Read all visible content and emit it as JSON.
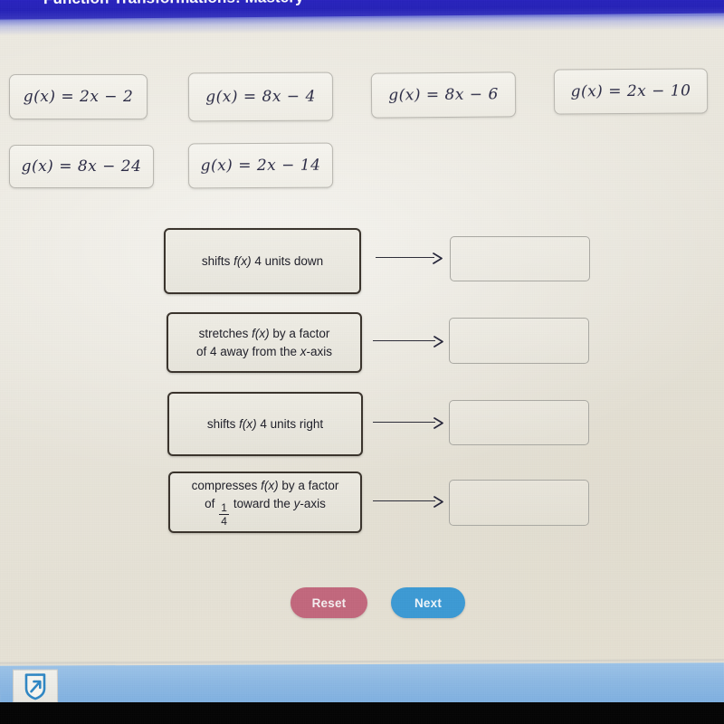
{
  "header": {
    "title": "Function Transformations: Mastery",
    "background_color": "#2622b8"
  },
  "equation_tiles": [
    {
      "label": "g(x)  =  2x  −  2",
      "name": "equation-tile-1"
    },
    {
      "label": "g(x)  =  8x  −  4",
      "name": "equation-tile-2"
    },
    {
      "label": "g(x)  =  8x  −  6",
      "name": "equation-tile-3"
    },
    {
      "label": "g(x)  =  2x  −  10",
      "name": "equation-tile-4"
    },
    {
      "label": "g(x)  =  8x  −  24",
      "name": "equation-tile-5"
    },
    {
      "label": "g(x)  =  2x  −  14",
      "name": "equation-tile-6"
    }
  ],
  "match_rows": [
    {
      "description_plain": "shifts f(x) 4 units down",
      "line1_pre": "shifts ",
      "line1_var": "f(x)",
      "line1_post": " 4 units down",
      "line2_pre": "",
      "line2_var": "",
      "line2_post": "",
      "has_fraction": false,
      "answer_value": ""
    },
    {
      "description_plain": "stretches f(x) by a factor of 4 away from the x-axis",
      "line1_pre": "stretches ",
      "line1_var": "f(x)",
      "line1_post": " by a factor",
      "line2_pre": "of 4 away from the ",
      "line2_var": "x",
      "line2_post": "-axis",
      "has_fraction": false,
      "answer_value": ""
    },
    {
      "description_plain": "shifts f(x) 4 units right",
      "line1_pre": "shifts ",
      "line1_var": "f(x)",
      "line1_post": " 4 units right",
      "line2_pre": "",
      "line2_var": "",
      "line2_post": "",
      "has_fraction": false,
      "answer_value": ""
    },
    {
      "description_plain": "compresses f(x) by a factor of 1/4 toward the y-axis",
      "line1_pre": "compresses ",
      "line1_var": "f(x)",
      "line1_post": " by a factor",
      "line2_pre": "of ",
      "line2_var": "y",
      "line2_post": " toward the ",
      "has_fraction": true,
      "fraction_numerator": "1",
      "fraction_denominator": "4",
      "line2_tail_pre": " toward the ",
      "line2_tail_var": "y",
      "line2_tail_post": "-axis",
      "answer_value": ""
    }
  ],
  "buttons": {
    "reset_label": "Reset",
    "reset_color": "#c2687d",
    "next_label": "Next",
    "next_color": "#3d9ad4"
  },
  "taskbar": {
    "app_icon": "shield-arrow-icon",
    "background_color": "#8cb8e3"
  }
}
